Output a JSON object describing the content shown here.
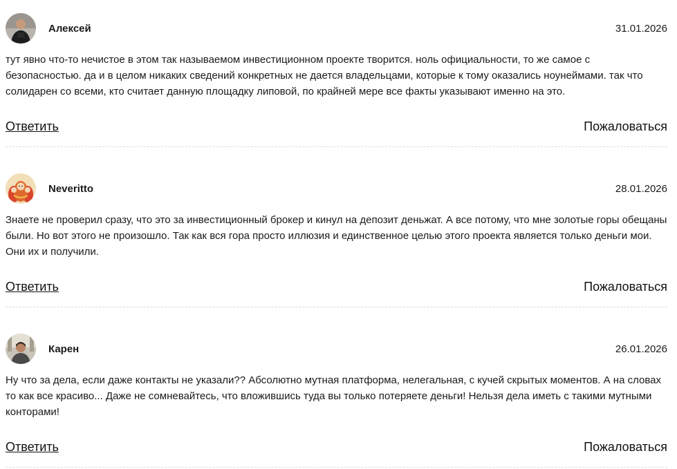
{
  "comments": [
    {
      "author": "Алексей",
      "date": "31.01.2026",
      "avatar": "photo-man-dark",
      "text": "тут явно что-то нечистое в этом так называемом инвестиционном проекте творится. ноль официальности, то же самое с безопасностью. да и в целом никаких сведений конкретных не дается владельцами, которые к тому оказались ноунеймами. так что солидарен со всеми, кто считает данную площадку липовой, по крайней мере все факты указывают именно на это.",
      "reply_label": "Ответить",
      "report_label": "Пожаловаться"
    },
    {
      "author": "Neveritto",
      "date": "28.01.2026",
      "avatar": "illustration-dolls",
      "text": "Знаете не проверил сразу, что это за инвестиционный брокер и кинул на депозит деньжат. А все потому, что мне золотые горы обещаны были. Но вот этого не произошло. Так как вся гора просто иллюзия и единственное целью этого проекта является только деньги мои. Они их и получили.",
      "reply_label": "Ответить",
      "report_label": "Пожаловаться"
    },
    {
      "author": "Карен",
      "date": "26.01.2026",
      "avatar": "photo-man-outdoor",
      "text": "Ну что за дела, если даже контакты не указали?? Абсолютно мутная платформа, нелегальная, с кучей скрытых моментов. А на словах то как все красиво... Даже не сомневайтесь, что вложившись туда вы только потеряете деньги! Нельзя дела иметь с такими мутными конторами!",
      "reply_label": "Ответить",
      "report_label": "Пожаловаться"
    }
  ]
}
